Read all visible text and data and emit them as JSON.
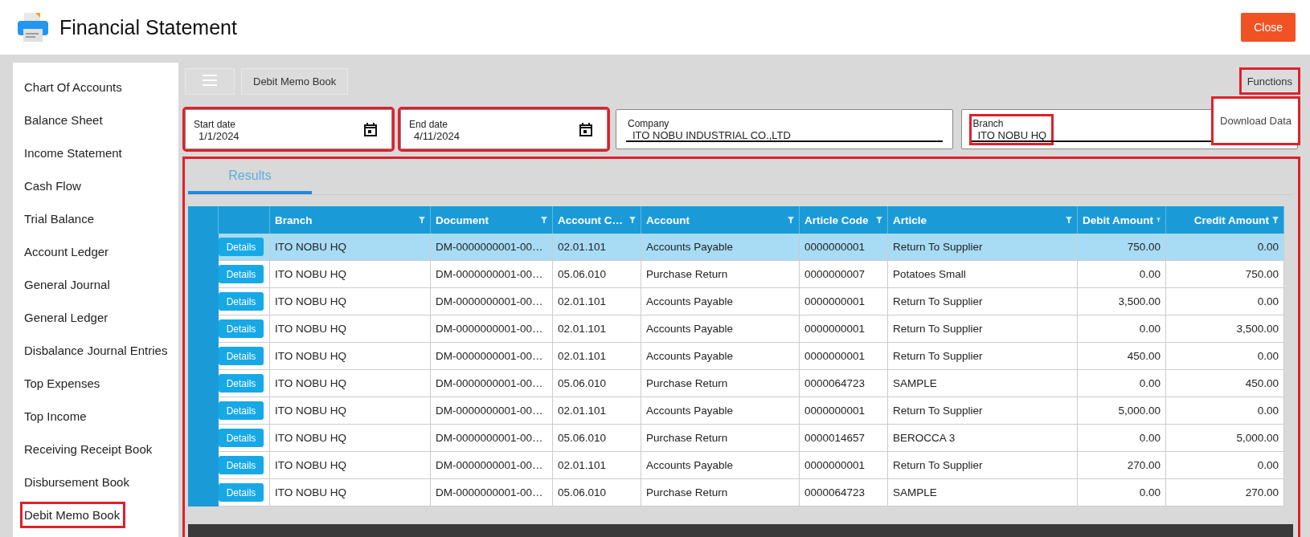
{
  "window": {
    "title": "Financial Statement",
    "close_button": "Close"
  },
  "sidebar": {
    "items": [
      {
        "label": "Chart Of Accounts",
        "highlighted": false
      },
      {
        "label": "Balance Sheet",
        "highlighted": false
      },
      {
        "label": "Income Statement",
        "highlighted": false
      },
      {
        "label": "Cash Flow",
        "highlighted": false
      },
      {
        "label": "Trial Balance",
        "highlighted": false
      },
      {
        "label": "Account Ledger",
        "highlighted": false
      },
      {
        "label": "General Journal",
        "highlighted": false
      },
      {
        "label": "General Ledger",
        "highlighted": false
      },
      {
        "label": "Disbalance Journal Entries",
        "highlighted": false
      },
      {
        "label": "Top Expenses",
        "highlighted": false
      },
      {
        "label": "Top Income",
        "highlighted": false
      },
      {
        "label": "Receiving Receipt Book",
        "highlighted": false
      },
      {
        "label": "Disbursement Book",
        "highlighted": false
      },
      {
        "label": "Debit Memo Book",
        "highlighted": true
      }
    ]
  },
  "toolbar": {
    "breadcrumb": "Debit Memo Book",
    "functions": {
      "label": "Functions",
      "highlighted": true
    },
    "menu": [
      {
        "label": "Download Data",
        "highlighted": true
      }
    ]
  },
  "filters": [
    {
      "kind": "date",
      "label": "Start date",
      "value": "1/1/2024",
      "highlighted": true
    },
    {
      "kind": "date",
      "label": "End date",
      "value": "4/11/2024",
      "highlighted": true
    },
    {
      "kind": "select",
      "label": "Company",
      "value": "ITO NOBU INDUSTRIAL CO.,LTD",
      "highlighted": false
    },
    {
      "kind": "select",
      "label": "Branch",
      "value": "ITO NOBU HQ",
      "highlighted": true
    }
  ],
  "results": {
    "highlighted": true,
    "tabs": [
      {
        "label": "Results",
        "selected": true
      }
    ],
    "table": {
      "columns": [
        "Branch",
        "Document",
        "Account C…",
        "Account",
        "Article Code",
        "Article",
        "Debit Amount",
        "Credit Amount"
      ],
      "rows": [
        {
          "selected": true,
          "action": "Details",
          "cells": [
            "ITO NOBU HQ",
            "DM-0000000001-00…",
            "02.01.101",
            "Accounts Payable",
            "0000000001",
            "Return To Supplier",
            "750.00",
            "0.00"
          ]
        },
        {
          "selected": false,
          "action": "Details",
          "cells": [
            "ITO NOBU HQ",
            "DM-0000000001-00…",
            "05.06.010",
            "Purchase Return",
            "0000000007",
            "Potatoes Small",
            "0.00",
            "750.00"
          ]
        },
        {
          "selected": false,
          "action": "Details",
          "cells": [
            "ITO NOBU HQ",
            "DM-0000000001-00…",
            "02.01.101",
            "Accounts Payable",
            "0000000001",
            "Return To Supplier",
            "3,500.00",
            "0.00"
          ]
        },
        {
          "selected": false,
          "action": "Details",
          "cells": [
            "ITO NOBU HQ",
            "DM-0000000001-00…",
            "02.01.101",
            "Accounts Payable",
            "0000000001",
            "Return To Supplier",
            "0.00",
            "3,500.00"
          ]
        },
        {
          "selected": false,
          "action": "Details",
          "cells": [
            "ITO NOBU HQ",
            "DM-0000000001-00…",
            "02.01.101",
            "Accounts Payable",
            "0000000001",
            "Return To Supplier",
            "450.00",
            "0.00"
          ]
        },
        {
          "selected": false,
          "action": "Details",
          "cells": [
            "ITO NOBU HQ",
            "DM-0000000001-00…",
            "05.06.010",
            "Purchase Return",
            "0000064723",
            "SAMPLE",
            "0.00",
            "450.00"
          ]
        },
        {
          "selected": false,
          "action": "Details",
          "cells": [
            "ITO NOBU HQ",
            "DM-0000000001-00…",
            "02.01.101",
            "Accounts Payable",
            "0000000001",
            "Return To Supplier",
            "5,000.00",
            "0.00"
          ]
        },
        {
          "selected": false,
          "action": "Details",
          "cells": [
            "ITO NOBU HQ",
            "DM-0000000001-00…",
            "05.06.010",
            "Purchase Return",
            "0000014657",
            "BEROCCA 3",
            "0.00",
            "5,000.00"
          ]
        },
        {
          "selected": false,
          "action": "Details",
          "cells": [
            "ITO NOBU HQ",
            "DM-0000000001-00…",
            "02.01.101",
            "Accounts Payable",
            "0000000001",
            "Return To Supplier",
            "270.00",
            "0.00"
          ]
        },
        {
          "selected": false,
          "action": "Details",
          "cells": [
            "ITO NOBU HQ",
            "DM-0000000001-00…",
            "05.06.010",
            "Purchase Return",
            "0000064723",
            "SAMPLE",
            "0.00",
            "270.00"
          ]
        }
      ]
    }
  }
}
